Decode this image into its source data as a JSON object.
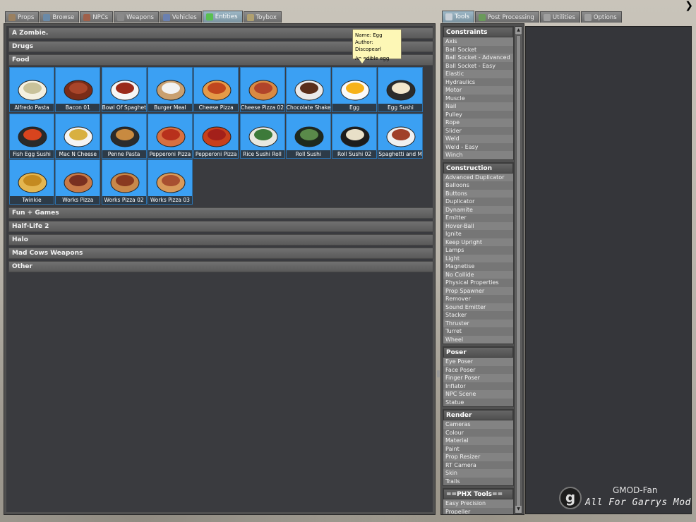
{
  "left_tabs": [
    {
      "label": "Props",
      "icon": "props-icon",
      "active": false
    },
    {
      "label": "Browse",
      "icon": "browse-icon",
      "active": false
    },
    {
      "label": "NPCs",
      "icon": "npc-icon",
      "active": false
    },
    {
      "label": "Weapons",
      "icon": "weapon-icon",
      "active": false
    },
    {
      "label": "Vehicles",
      "icon": "vehicle-icon",
      "active": false
    },
    {
      "label": "Entities",
      "icon": "entities-icon",
      "active": true
    },
    {
      "label": "Toybox",
      "icon": "toybox-icon",
      "active": false
    }
  ],
  "right_tabs": [
    {
      "label": "Tools",
      "icon": "wrench-icon",
      "active": true
    },
    {
      "label": "Post Processing",
      "icon": "post-processing-icon",
      "active": false
    },
    {
      "label": "Utilities",
      "icon": "utilities-icon",
      "active": false
    },
    {
      "label": "Options",
      "icon": "options-icon",
      "active": false
    }
  ],
  "categories_top": [
    "A Zombie.",
    "Drugs",
    "Food"
  ],
  "categories_bottom": [
    "Fun + Games",
    "Half-Life 2",
    "Halo",
    "Mad Cows Weapons",
    "Other"
  ],
  "food_items": [
    "Alfredo Pasta",
    "Bacon 01",
    "Bowl Of Spaghetti",
    "Burger Meal",
    "Cheese Pizza",
    "Cheese Pizza 02",
    "Chocolate Shake",
    "Egg",
    "Egg Sushi",
    "Fish Egg Sushi",
    "Mac N Cheese",
    "Penne Pasta",
    "Pepperoni Pizza",
    "Pepperoni Pizza",
    "Rice Sushi Roll",
    "Roll Sushi",
    "Roll Sushi 02",
    "Spaghetti and Mea...",
    "Twinkie",
    "Works Pizza",
    "Works Pizza 02",
    "Works Pizza 03"
  ],
  "tooltip": {
    "name": "Name: Egg",
    "author": "Author: Discopearl",
    "description": "An edible egg"
  },
  "tool_groups": [
    {
      "title": "Constraints",
      "items": [
        "Axis",
        "Ball Socket",
        "Ball Socket - Advanced",
        "Ball Socket - Easy",
        "Elastic",
        "Hydraulics",
        "Motor",
        "Muscle",
        "Nail",
        "Pulley",
        "Rope",
        "Slider",
        "Weld",
        "Weld - Easy",
        "Winch"
      ]
    },
    {
      "title": "Construction",
      "items": [
        "Advanced Duplicator",
        "Balloons",
        "Buttons",
        "Duplicator",
        "Dynamite",
        "Emitter",
        "Hover-Ball",
        "Ignite",
        "Keep Upright",
        "Lamps",
        "Light",
        "Magnetise",
        "No Collide",
        "Physical Properties",
        "Prop Spawner",
        "Remover",
        "Sound Emitter",
        "Stacker",
        "Thruster",
        "Turret",
        "Wheel"
      ]
    },
    {
      "title": "Poser",
      "items": [
        "Eye Poser",
        "Face Poser",
        "Finger Poser",
        "Inflator",
        "NPC Scene",
        "Statue"
      ]
    },
    {
      "title": "Render",
      "items": [
        "Cameras",
        "Colour",
        "Material",
        "Paint",
        "Prop Resizer",
        "RT Camera",
        "Skin",
        "Trails"
      ]
    },
    {
      "title": "==PHX Tools==",
      "items": [
        "Easy Precision",
        "Propeller"
      ]
    }
  ],
  "watermark": {
    "logo_letter": "g",
    "title": "GMOD-Fan",
    "subtitle": "All For Garrys Mod"
  },
  "colors": {
    "item_bg": "#3ba0f3",
    "panel_dark": "#3a3b3f",
    "tooltip_bg": "#fdf7b6"
  }
}
